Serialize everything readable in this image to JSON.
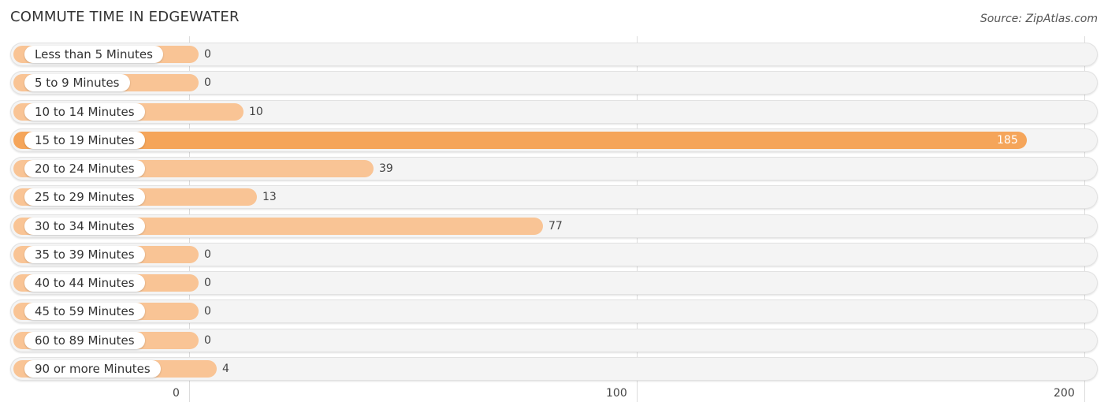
{
  "header": {
    "title": "COMMUTE TIME IN EDGEWATER",
    "source": "Source: ZipAtlas.com"
  },
  "colors": {
    "bar_normal": "#f9c495",
    "bar_highlight": "#f5a55a",
    "track": "#f4f4f4"
  },
  "chart_data": {
    "type": "bar",
    "orientation": "horizontal",
    "title": "COMMUTE TIME IN EDGEWATER",
    "xlabel": "",
    "ylabel": "",
    "xlim": [
      0,
      200
    ],
    "xticks": [
      0,
      100,
      200
    ],
    "grid": true,
    "highlight_category": "15 to 19 Minutes",
    "categories": [
      "Less than 5 Minutes",
      "5 to 9 Minutes",
      "10 to 14 Minutes",
      "15 to 19 Minutes",
      "20 to 24 Minutes",
      "25 to 29 Minutes",
      "30 to 34 Minutes",
      "35 to 39 Minutes",
      "40 to 44 Minutes",
      "45 to 59 Minutes",
      "60 to 89 Minutes",
      "90 or more Minutes"
    ],
    "values": [
      0,
      0,
      10,
      185,
      39,
      13,
      77,
      0,
      0,
      0,
      0,
      4
    ]
  }
}
